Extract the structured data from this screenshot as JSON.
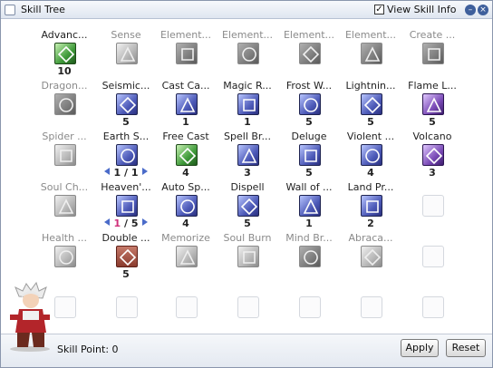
{
  "window": {
    "title": "Skill Tree",
    "view_skill_info_label": "View Skill Info",
    "view_skill_info_checked": true
  },
  "skills": [
    {
      "label": "Advanc...",
      "row": 0,
      "col": 0,
      "state": "on",
      "tone": "green",
      "level": "10"
    },
    {
      "label": "Sense",
      "row": 0,
      "col": 1,
      "state": "off",
      "level": ""
    },
    {
      "label": "Element...",
      "row": 0,
      "col": 2,
      "state": "off",
      "tone": "dark",
      "level": ""
    },
    {
      "label": "Element...",
      "row": 0,
      "col": 3,
      "state": "off",
      "tone": "dark",
      "level": ""
    },
    {
      "label": "Element...",
      "row": 0,
      "col": 4,
      "state": "off",
      "tone": "dark",
      "level": ""
    },
    {
      "label": "Element...",
      "row": 0,
      "col": 5,
      "state": "off",
      "tone": "dark",
      "level": ""
    },
    {
      "label": "Create ...",
      "row": 0,
      "col": 6,
      "state": "off",
      "tone": "dark",
      "level": ""
    },
    {
      "label": "Dragon...",
      "row": 1,
      "col": 0,
      "state": "off",
      "tone": "dark",
      "level": ""
    },
    {
      "label": "Seismic...",
      "row": 1,
      "col": 1,
      "state": "on",
      "level": "5"
    },
    {
      "label": "Cast Ca...",
      "row": 1,
      "col": 2,
      "state": "on",
      "level": "1"
    },
    {
      "label": "Magic R...",
      "row": 1,
      "col": 3,
      "state": "on",
      "level": "1"
    },
    {
      "label": "Frost W...",
      "row": 1,
      "col": 4,
      "state": "on",
      "level": "5"
    },
    {
      "label": "Lightnin...",
      "row": 1,
      "col": 5,
      "state": "on",
      "level": "5"
    },
    {
      "label": "Flame L...",
      "row": 1,
      "col": 6,
      "state": "on",
      "tone": "violet",
      "level": "5"
    },
    {
      "label": "Spider ...",
      "row": 2,
      "col": 0,
      "state": "off",
      "level": ""
    },
    {
      "label": "Earth S...",
      "row": 2,
      "col": 1,
      "state": "on",
      "level_current": "1",
      "level_max": "1",
      "arrows": true
    },
    {
      "label": "Free Cast",
      "row": 2,
      "col": 2,
      "state": "on",
      "tone": "green",
      "level": "4"
    },
    {
      "label": "Spell Br...",
      "row": 2,
      "col": 3,
      "state": "on",
      "level": "3"
    },
    {
      "label": "Deluge",
      "row": 2,
      "col": 4,
      "state": "on",
      "level": "5"
    },
    {
      "label": "Violent ...",
      "row": 2,
      "col": 5,
      "state": "on",
      "level": "4"
    },
    {
      "label": "Volcano",
      "row": 2,
      "col": 6,
      "state": "on",
      "tone": "violet",
      "level": "3"
    },
    {
      "label": "Soul Ch...",
      "row": 3,
      "col": 0,
      "state": "off",
      "level": ""
    },
    {
      "label": "Heaven'...",
      "row": 3,
      "col": 1,
      "state": "on",
      "level_current": "1",
      "level_max": "5",
      "arrows": true,
      "pink": true
    },
    {
      "label": "Auto Sp...",
      "row": 3,
      "col": 2,
      "state": "on",
      "level": "4"
    },
    {
      "label": "Dispell",
      "row": 3,
      "col": 3,
      "state": "on",
      "level": "5"
    },
    {
      "label": "Wall of ...",
      "row": 3,
      "col": 4,
      "state": "on",
      "level": "1"
    },
    {
      "label": "Land Pr...",
      "row": 3,
      "col": 5,
      "state": "on",
      "level": "2"
    },
    {
      "label": "Health ...",
      "row": 4,
      "col": 0,
      "state": "off",
      "level": ""
    },
    {
      "label": "Double ...",
      "row": 4,
      "col": 1,
      "state": "magic",
      "level": "5"
    },
    {
      "label": "Memorize",
      "row": 4,
      "col": 2,
      "state": "off",
      "level": ""
    },
    {
      "label": "Soul Burn",
      "row": 4,
      "col": 3,
      "state": "off",
      "level": ""
    },
    {
      "label": "Mind Br...",
      "row": 4,
      "col": 4,
      "state": "off",
      "tone": "dark",
      "level": ""
    },
    {
      "label": "Abraca...",
      "row": 4,
      "col": 5,
      "state": "off",
      "level": ""
    }
  ],
  "empty_slots": [
    {
      "row": 3,
      "col": 6
    },
    {
      "row": 4,
      "col": 6
    },
    {
      "row": 5,
      "col": 0
    },
    {
      "row": 5,
      "col": 1
    },
    {
      "row": 5,
      "col": 2
    },
    {
      "row": 5,
      "col": 3
    },
    {
      "row": 5,
      "col": 4
    },
    {
      "row": 5,
      "col": 5
    },
    {
      "row": 5,
      "col": 6
    }
  ],
  "footer": {
    "skill_point_label": "Skill Point: 0",
    "apply_label": "Apply",
    "reset_label": "Reset"
  }
}
